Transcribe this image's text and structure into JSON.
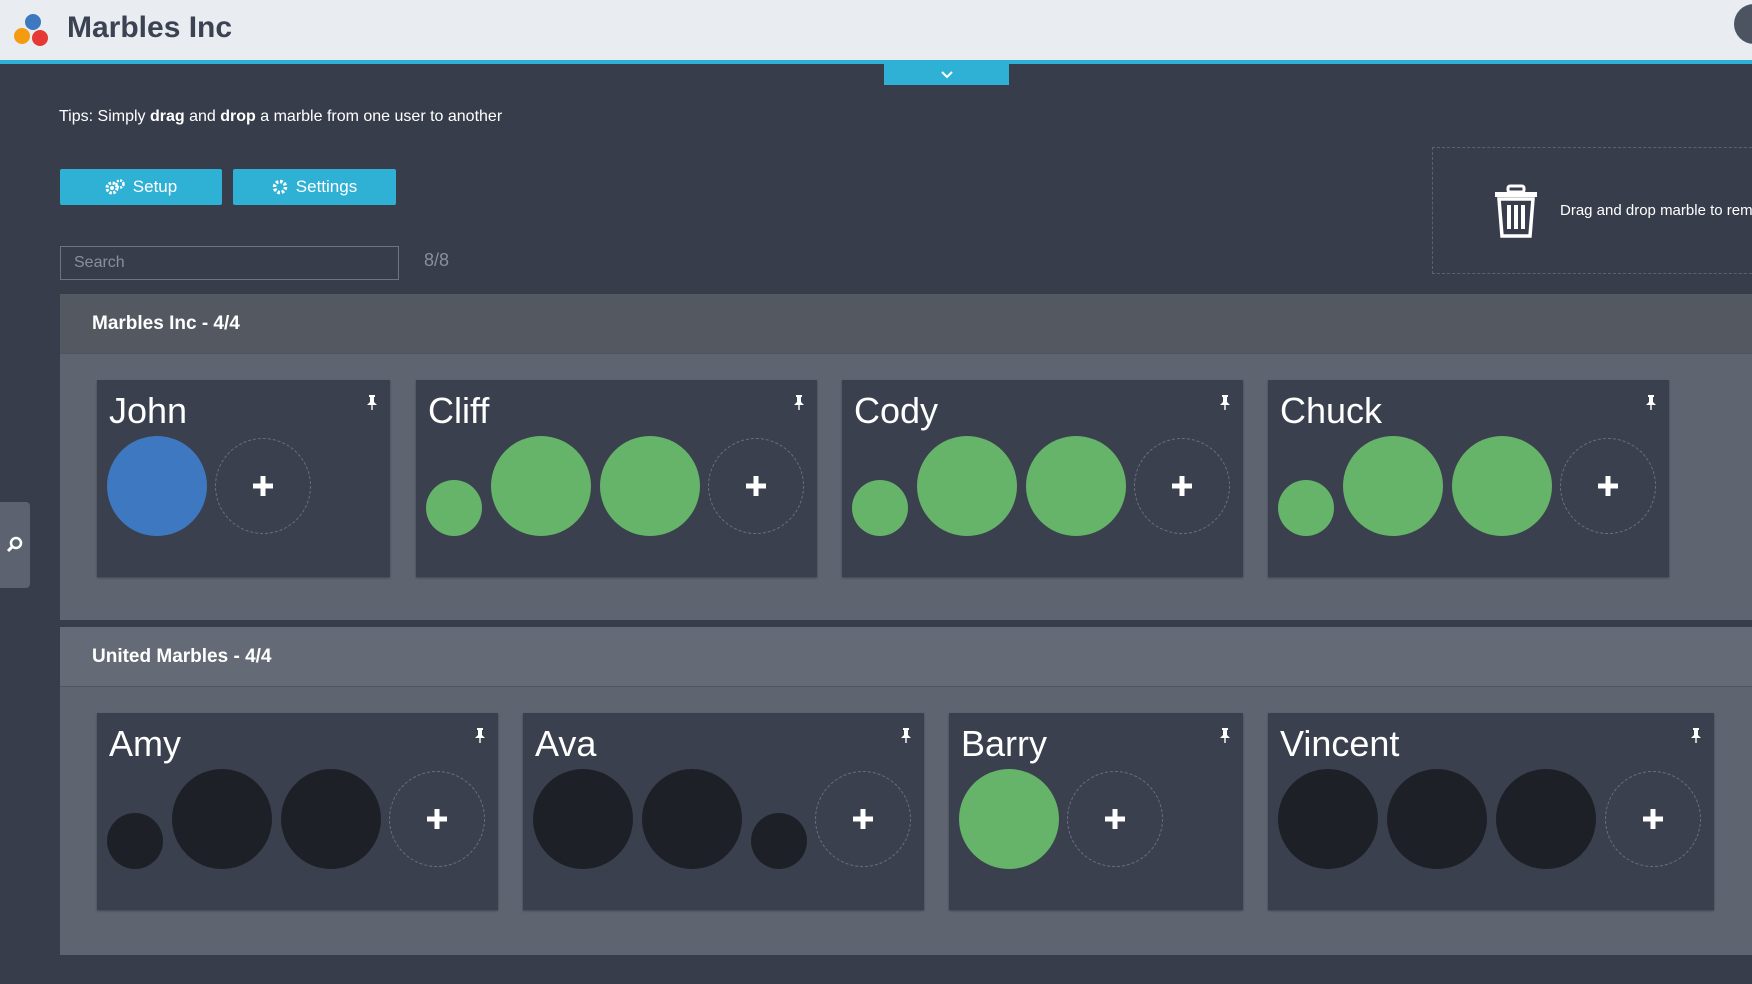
{
  "app": {
    "title": "Marbles Inc"
  },
  "tips": {
    "prefix": "Tips: Simply ",
    "drag": "drag",
    "middle": " and ",
    "drop": "drop",
    "suffix": " a marble from one user to another"
  },
  "toolbar": {
    "setup_label": "Setup",
    "settings_label": "Settings"
  },
  "search": {
    "placeholder": "Search",
    "value": "",
    "count": "8/8"
  },
  "trash": {
    "text": "Drag and drop marble to remo"
  },
  "colors": {
    "accent": "#2fb1d6",
    "green": "#66b36a",
    "blue": "#3e78c0",
    "black": "#1e2027"
  },
  "groups": [
    {
      "title": "Marbles Inc - 4/4",
      "users": [
        {
          "name": "John",
          "marbles": [
            "large-blue"
          ]
        },
        {
          "name": "Cliff",
          "marbles": [
            "small-green",
            "large-green",
            "large-green"
          ]
        },
        {
          "name": "Cody",
          "marbles": [
            "small-green",
            "large-green",
            "large-green"
          ]
        },
        {
          "name": "Chuck",
          "marbles": [
            "small-green",
            "large-green",
            "large-green"
          ]
        }
      ]
    },
    {
      "title": "United Marbles - 4/4",
      "users": [
        {
          "name": "Amy",
          "marbles": [
            "small-black",
            "large-black",
            "large-black"
          ]
        },
        {
          "name": "Ava",
          "marbles": [
            "large-black",
            "large-black",
            "small-black"
          ]
        },
        {
          "name": "Barry",
          "marbles": [
            "large-green"
          ]
        },
        {
          "name": "Vincent",
          "marbles": [
            "large-black",
            "large-black",
            "large-black"
          ]
        }
      ]
    }
  ]
}
